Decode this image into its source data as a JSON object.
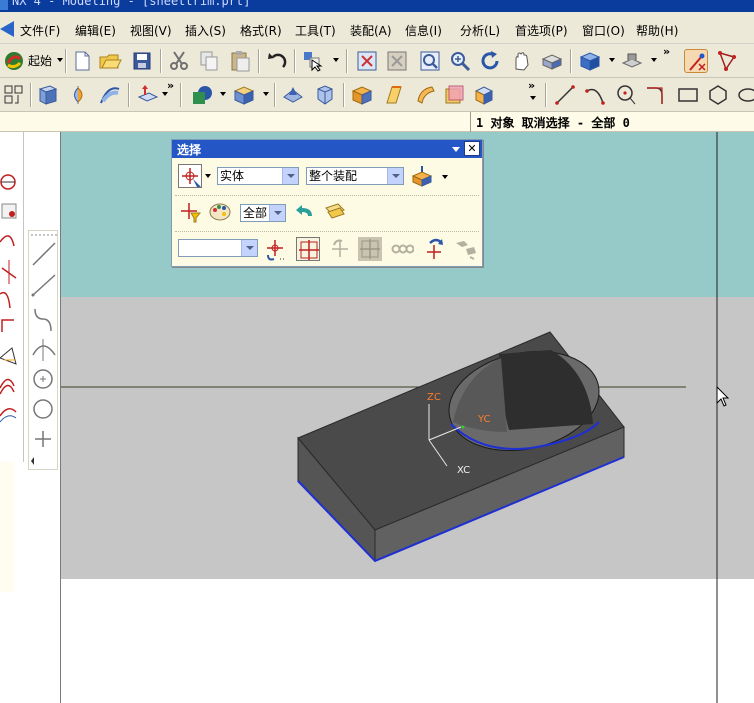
{
  "window": {
    "title": "NX 4 - Modeling - [sheettrim.prt]"
  },
  "menu": {
    "items": [
      {
        "label": "文件(F)"
      },
      {
        "label": "编辑(E)"
      },
      {
        "label": "视图(V)"
      },
      {
        "label": "插入(S)"
      },
      {
        "label": "格式(R)"
      },
      {
        "label": "工具(T)"
      },
      {
        "label": "装配(A)"
      },
      {
        "label": "信息(I)"
      },
      {
        "label": "分析(L)"
      },
      {
        "label": "首选项(P)"
      },
      {
        "label": "窗口(O)"
      },
      {
        "label": "帮助(H)"
      }
    ]
  },
  "toolbar": {
    "start_label": "起始",
    "overflow_glyph": "»"
  },
  "status": {
    "cue_text": "1 对象 取消选择  - 全部 0"
  },
  "select_dialog": {
    "title": "选择",
    "close_glyph": "✕",
    "type_filter": "实体",
    "scope": "整个装配",
    "layer_filter": "全部",
    "extra_filter": ""
  },
  "viewport": {
    "axes": {
      "zc": "ZC",
      "yc": "YC",
      "xc": "XC"
    },
    "top_band_color": "#96cac9",
    "mid_band_color": "#c6c6c6",
    "model_color": "#4a4a4a",
    "edge_color": "#1e2fd4"
  },
  "icons": {
    "selection_filter_icon": "crosshair-filter-icon",
    "color_filter_icon": "palette-icon"
  }
}
